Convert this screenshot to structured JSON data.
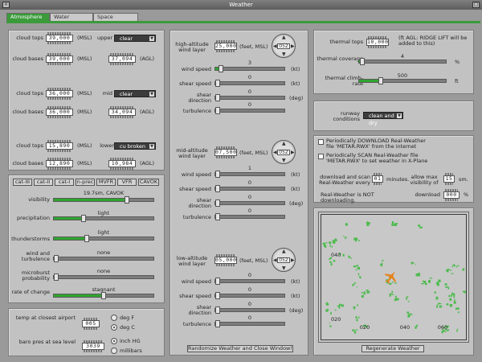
{
  "window": {
    "title": "Weather",
    "close_glyph": "×",
    "min_glyph": "□"
  },
  "tabs": [
    {
      "label": "Atmosphere"
    },
    {
      "label": "Water"
    },
    {
      "label": "Space"
    }
  ],
  "clouds": {
    "tops_label": "cloud tops",
    "bases_label": "cloud bases",
    "msl": "(MSL)",
    "agl": "(AGL)",
    "layers": [
      {
        "name": "upper",
        "type": "clear",
        "tops": "39,000",
        "bases": "39,000",
        "agl": "37,094"
      },
      {
        "name": "mid",
        "type": "clear",
        "tops": "36,000",
        "bases": "36,000",
        "agl": "34,094"
      },
      {
        "name": "lower",
        "type": "cu broken",
        "tops": "15,890",
        "bases": "12,890",
        "agl": "10,984"
      }
    ]
  },
  "presets": {
    "buttons": [
      "cat-III",
      "cat-II",
      "cat-I",
      "n-prec",
      "MVFR",
      "VFR",
      "CAVOK"
    ]
  },
  "conditions": {
    "visibility": {
      "label": "visibility",
      "value_text": "19.7sm, CAVOK",
      "level": 0.73
    },
    "precipitation": {
      "label": "precipitation",
      "value_text": "light",
      "level": 0.3
    },
    "thunderstorms": {
      "label": "thunderstorms",
      "value_text": "light",
      "level": 0.33
    },
    "wind_turbulence": {
      "label": "wind and turbulence",
      "value_text": "none",
      "level": 0.0
    },
    "microburst": {
      "label": "microburst probability",
      "value_text": "none",
      "level": 0.0
    },
    "rate_of_change": {
      "label": "rate of change",
      "value_text": "stagnant",
      "level": 0.5
    }
  },
  "temperature": {
    "temp_label": "temp at closest airport",
    "temp_value": "005",
    "deg_f": "deg F",
    "deg_c": "deg C",
    "unit": "deg C",
    "baro_label": "baro pres at sea level",
    "baro_value": "3039",
    "inch_hg": "inch HG",
    "millibars": "millibars",
    "baro_unit": "inch HG"
  },
  "winds": {
    "feet_msl": "(feet, MSL)",
    "kt": "(kt)",
    "deg": "(deg)",
    "speed_label": "wind speed",
    "shear_speed_label": "shear speed",
    "shear_dir_label": "shear direction",
    "turbulence_label": "turbulence",
    "layers": [
      {
        "name": "high-altitude wind layer",
        "alt": "25,000",
        "heading": "052",
        "speed": "3",
        "shear_speed": "0",
        "shear_dir": "0",
        "turbulence": "0"
      },
      {
        "name": "mid-altitude wind layer",
        "alt": "07,500",
        "heading": "052",
        "speed": "1",
        "shear_speed": "0",
        "shear_dir": "0",
        "turbulence": "0"
      },
      {
        "name": "low-altitude wind layer",
        "alt": "05,000",
        "heading": "052",
        "speed": "0",
        "shear_speed": "0",
        "shear_dir": "0",
        "turbulence": "0"
      }
    ],
    "randomize_button": "Randomize Weather and Close Window!"
  },
  "thermals": {
    "tops_label": "thermal tops",
    "tops_value": "10,000",
    "tops_note": "(ft AGL: RIDGE LIFT will be added to this)",
    "coverage_label": "thermal coverage",
    "coverage_value": "4",
    "coverage_unit": "%",
    "coverage_level": 0.04,
    "climb_label": "thermal climb-rate",
    "climb_value": "500",
    "climb_unit": "ft",
    "climb_level": 0.25
  },
  "runway": {
    "label": "runway conditions",
    "value": "clean and dry"
  },
  "real_weather": {
    "download_label": "Periodically DOWNLOAD Real-Weather file 'METAR.RWX' from the internet",
    "scan_label": "Periodically SCAN Real-Weather file 'METAR.RWX' to set weather in X-Plane",
    "every_label": "download and scan Real-Weather every",
    "every_value": "01",
    "every_unit": "minutes.",
    "vis_label": "allow max visibility of",
    "vis_value": "15",
    "vis_unit": "sm.",
    "status": "Real-Weather is NOT downloading.",
    "download_label2": "download",
    "download_value": "000",
    "download_unit": "%"
  },
  "map": {
    "x_ticks": [
      "020",
      "040",
      "060"
    ],
    "y_ticks": [
      "040",
      "020"
    ],
    "regenerate_button": "Regenerate Weather",
    "colors": {
      "cloud": "#4dbb4d",
      "plane": "#e8831c"
    }
  }
}
